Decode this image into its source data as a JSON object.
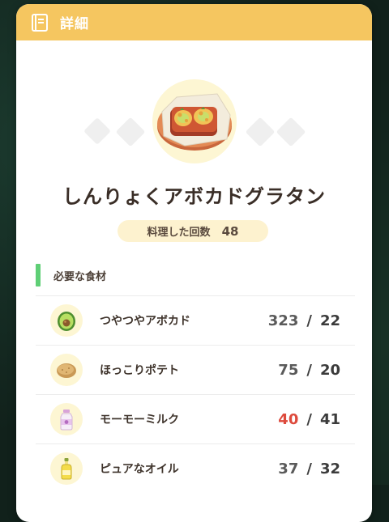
{
  "header": {
    "title": "詳細",
    "icon": "book-icon"
  },
  "dish": {
    "name": "しんりょくアボカドグラタン",
    "count_label": "料理した回数",
    "count_value": "48",
    "image": "avocado-gratin-icon"
  },
  "ingredients_section": {
    "title": "必要な食材"
  },
  "ingredients": [
    {
      "name": "つやつやアボカド",
      "have": "323",
      "need": "22",
      "icon": "avocado-icon",
      "short": false
    },
    {
      "name": "ほっこりポテト",
      "have": "75",
      "need": "20",
      "icon": "potato-icon",
      "short": false
    },
    {
      "name": "モーモーミルク",
      "have": "40",
      "need": "41",
      "icon": "milk-icon",
      "short": true
    },
    {
      "name": "ピュアなオイル",
      "have": "37",
      "need": "32",
      "icon": "oil-icon",
      "short": false
    }
  ],
  "colors": {
    "header": "#f5c660",
    "section_accent": "#5fcf76",
    "shortage": "#dd4a3c",
    "pill": "#fdf2cf"
  }
}
